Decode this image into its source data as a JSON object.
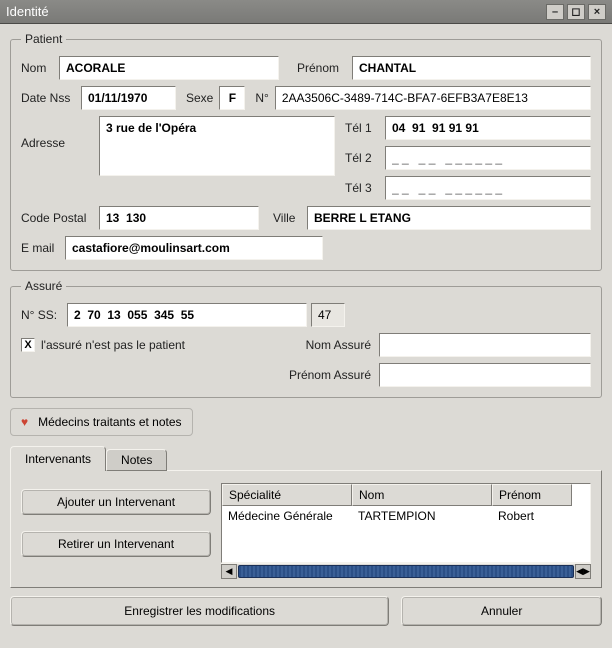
{
  "window": {
    "title": "Identité"
  },
  "patient": {
    "legend": "Patient",
    "labels": {
      "nom": "Nom",
      "prenom": "Prénom",
      "datenss": "Date Nss",
      "sexe": "Sexe",
      "num": "N°",
      "adresse": "Adresse",
      "tel1": "Tél 1",
      "tel2": "Tél 2",
      "tel3": "Tél 3",
      "codepostal": "Code Postal",
      "ville": "Ville",
      "email": "E mail"
    },
    "nom": "ACORALE",
    "prenom": "CHANTAL",
    "date_nss": "01/11/1970",
    "sexe": "F",
    "num": "2AA3506C-3489-714C-BFA7-6EFB3A7E8E13",
    "adresse": "3 rue de l'Opéra",
    "tel1": "04  91  91 91 91",
    "tel2": "_ _   _ _   _ _ _ _ _ _",
    "tel3": "_ _   _ _   _ _ _ _ _ _",
    "code_postal": "13  130",
    "ville": "BERRE L ETANG",
    "email": "castafiore@moulinsart.com"
  },
  "assure": {
    "legend": "Assuré",
    "labels": {
      "nss": "N° SS:",
      "notpatient": "l'assuré n'est pas le patient",
      "nom": "Nom Assuré",
      "prenom": "Prénom Assuré"
    },
    "nss": "2  70  13  055  345  55",
    "key": "47",
    "not_patient_checked": "X",
    "nom": "",
    "prenom": ""
  },
  "section": {
    "title": "Médecins traitants et notes",
    "icon": "♥"
  },
  "tabs": {
    "intervenants": "Intervenants",
    "notes": "Notes"
  },
  "intervenants": {
    "add_btn": "Ajouter un Intervenant",
    "remove_btn": "Retirer un Intervenant",
    "columns": [
      "Spécialité",
      "Nom",
      "Prénom"
    ],
    "rows": [
      {
        "specialite": "Médecine Générale",
        "nom": "TARTEMPION",
        "prenom": "Robert"
      }
    ]
  },
  "footer": {
    "save": "Enregistrer les modifications",
    "cancel": "Annuler"
  }
}
